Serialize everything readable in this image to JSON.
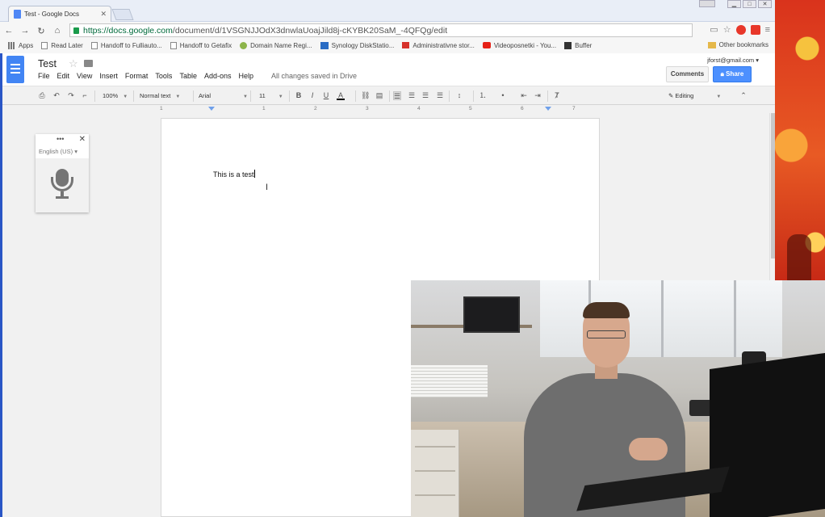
{
  "browser": {
    "tab_title": "Test - Google Docs",
    "url_domain": "https://docs.google.com",
    "url_path": "/document/d/1VSGNJJOdX3dnwlaUoajJild8j-cKYBK20SaM_-4QFQg/edit",
    "bookmarks": [
      {
        "label": "Apps",
        "icon": "apps-icon"
      },
      {
        "label": "Read Later",
        "icon": "page-icon"
      },
      {
        "label": "Handoff to Fulliauto...",
        "icon": "page-icon"
      },
      {
        "label": "Handoff to Getafix",
        "icon": "page-icon"
      },
      {
        "label": "Domain Name Regi...",
        "icon": "leaf-icon"
      },
      {
        "label": "Synology DiskStatio...",
        "icon": "dsm-icon"
      },
      {
        "label": "Administrativne stor...",
        "icon": "gmail-icon"
      },
      {
        "label": "Videoposnetki - You...",
        "icon": "youtube-icon"
      },
      {
        "label": "Buffer",
        "icon": "buffer-icon"
      }
    ],
    "other_bookmarks": "Other bookmarks"
  },
  "docs": {
    "title": "Test",
    "menu": [
      "File",
      "Edit",
      "View",
      "Insert",
      "Format",
      "Tools",
      "Table",
      "Add-ons",
      "Help"
    ],
    "save_status": "All changes saved in Drive",
    "account": "jforst@gmail.com",
    "comments_label": "Comments",
    "share_label": "Share",
    "toolbar": {
      "zoom": "100%",
      "style": "Normal text",
      "font": "Arial",
      "size": "11",
      "mode": "Editing"
    },
    "ruler_ticks": [
      "1",
      "1",
      "2",
      "3",
      "4",
      "5",
      "6",
      "7"
    ],
    "body_text": "This is a test"
  },
  "voice_typing": {
    "language": "English (US)"
  },
  "colors": {
    "docs_blue": "#4285f4",
    "share_blue": "#4d90fe",
    "sidebar_accent": "#2a56c6"
  }
}
